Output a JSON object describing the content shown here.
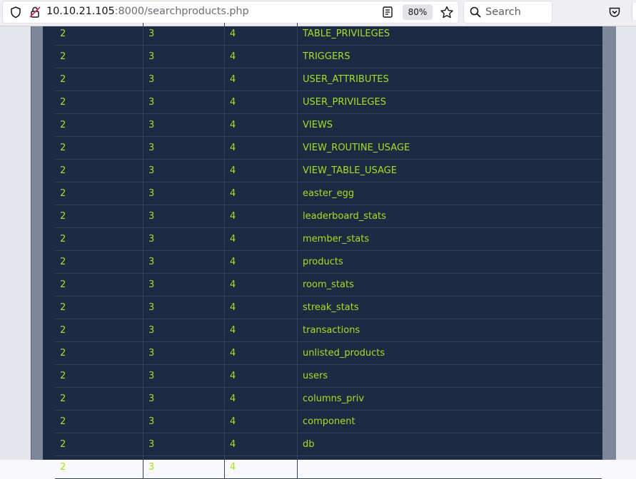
{
  "browser": {
    "url_host": "10.10.21.105",
    "url_rest": ":8000/searchproducts.php",
    "zoom": "80%",
    "search_placeholder": "Search"
  },
  "table": {
    "rows": [
      [
        "2",
        "3",
        "4",
        "TABLE_PRIVILEGES"
      ],
      [
        "2",
        "3",
        "4",
        "TRIGGERS"
      ],
      [
        "2",
        "3",
        "4",
        "USER_ATTRIBUTES"
      ],
      [
        "2",
        "3",
        "4",
        "USER_PRIVILEGES"
      ],
      [
        "2",
        "3",
        "4",
        "VIEWS"
      ],
      [
        "2",
        "3",
        "4",
        "VIEW_ROUTINE_USAGE"
      ],
      [
        "2",
        "3",
        "4",
        "VIEW_TABLE_USAGE"
      ],
      [
        "2",
        "3",
        "4",
        "easter_egg"
      ],
      [
        "2",
        "3",
        "4",
        "leaderboard_stats"
      ],
      [
        "2",
        "3",
        "4",
        "member_stats"
      ],
      [
        "2",
        "3",
        "4",
        "products"
      ],
      [
        "2",
        "3",
        "4",
        "room_stats"
      ],
      [
        "2",
        "3",
        "4",
        "streak_stats"
      ],
      [
        "2",
        "3",
        "4",
        "transactions"
      ],
      [
        "2",
        "3",
        "4",
        "unlisted_products"
      ],
      [
        "2",
        "3",
        "4",
        "users"
      ],
      [
        "2",
        "3",
        "4",
        "columns_priv"
      ],
      [
        "2",
        "3",
        "4",
        "component"
      ],
      [
        "2",
        "3",
        "4",
        "db"
      ],
      [
        "2",
        "3",
        "4",
        ""
      ]
    ]
  },
  "icons": {
    "site_info": "shield-icon",
    "connection": "lock-insecure-icon",
    "reader": "reader-view-icon",
    "bookmark": "star-icon",
    "search": "search-icon",
    "pocket": "pocket-icon"
  }
}
